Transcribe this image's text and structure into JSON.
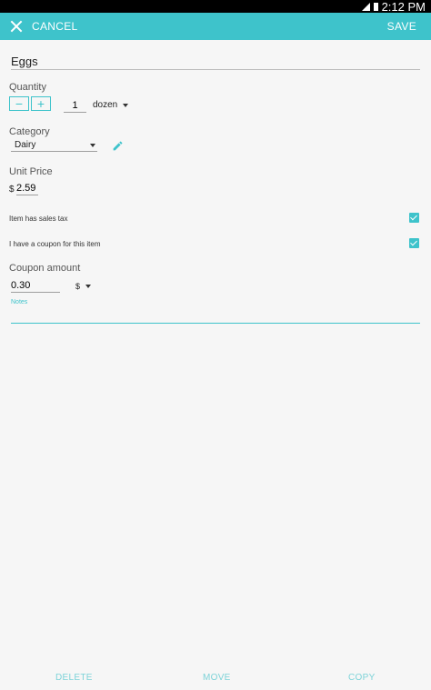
{
  "status_bar": {
    "time": "2:12 PM",
    "icons": [
      "signal-icon",
      "battery-icon"
    ]
  },
  "toolbar": {
    "cancel_label": "CANCEL",
    "save_label": "SAVE",
    "accent": "#3ec3cb"
  },
  "form": {
    "item_name": "Eggs",
    "quantity_label": "Quantity",
    "decrement_label": "−",
    "increment_label": "+",
    "quantity_value": "1",
    "unit_value": "dozen",
    "category_label": "Category",
    "category_value": "Dairy",
    "unit_price_label": "Unit Price",
    "currency_symbol": "$",
    "unit_price_value": "2.59",
    "sales_tax_label": "Item has sales tax",
    "sales_tax_checked": true,
    "coupon_toggle_label": "I have a coupon for this item",
    "coupon_checked": true,
    "coupon_amount_label": "Coupon amount",
    "coupon_amount_value": "0.30",
    "coupon_type_value": "$",
    "notes_label": "Notes"
  },
  "bottom_bar": {
    "delete_label": "DELETE",
    "move_label": "MOVE",
    "copy_label": "COPY"
  }
}
